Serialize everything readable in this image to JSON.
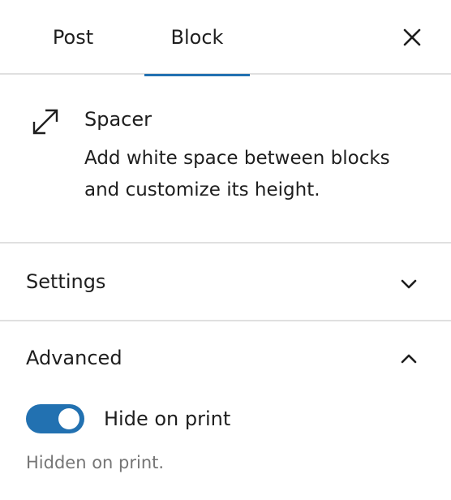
{
  "tabs": {
    "post_label": "Post",
    "block_label": "Block",
    "active": "Block"
  },
  "block": {
    "icon": "resize-arrows-icon",
    "title": "Spacer",
    "description": "Add white space between blocks and customize its height."
  },
  "settings_panel": {
    "title": "Settings",
    "expanded": false
  },
  "advanced_panel": {
    "title": "Advanced",
    "expanded": true,
    "toggle": {
      "label": "Hide on print",
      "checked": true,
      "help": "Hidden on print."
    }
  },
  "colors": {
    "accent": "#2271b1",
    "border": "#e0e0e0",
    "muted_text": "#757575"
  }
}
